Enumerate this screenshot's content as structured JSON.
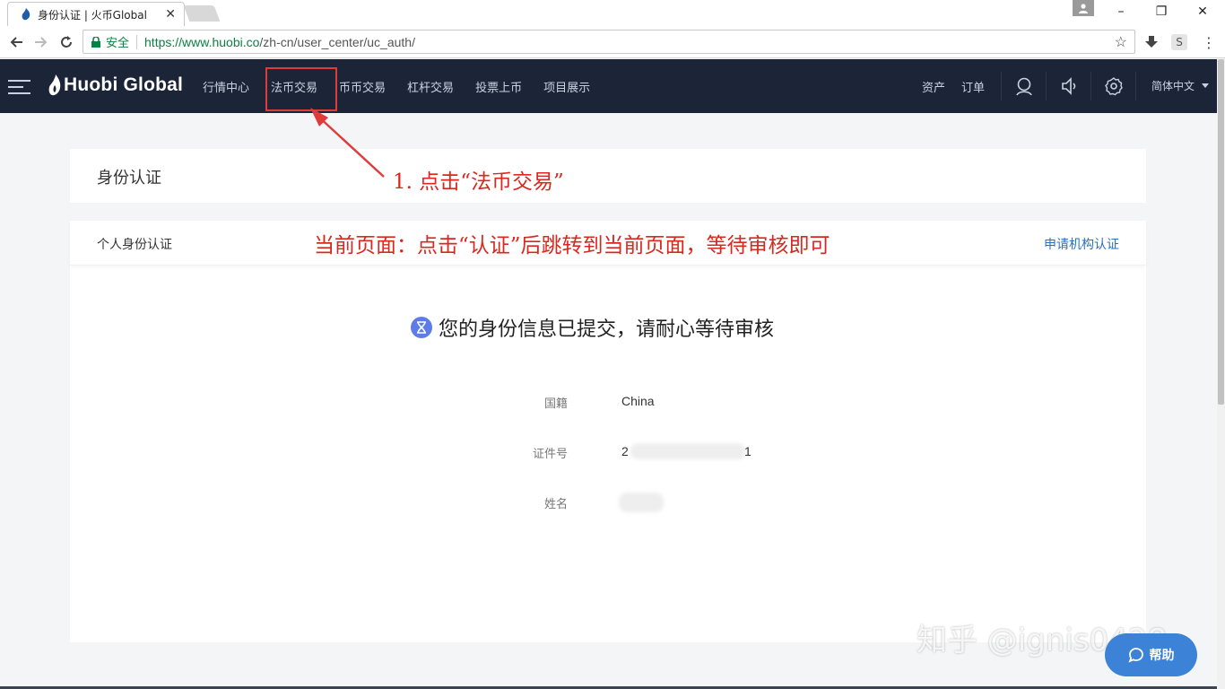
{
  "browser": {
    "tab_title": "身份认证 | 火币Global",
    "secure_label": "安全",
    "url_host": "https://www.huobi.co",
    "url_path": "/zh-cn/user_center/uc_auth/"
  },
  "header": {
    "logo_text": "Huobi Global",
    "nav_items": [
      "行情中心",
      "法币交易",
      "币币交易",
      "杠杆交易",
      "投票上币",
      "项目展示"
    ],
    "assets": "资产",
    "orders": "订单",
    "language": "简体中文"
  },
  "page": {
    "title": "身份认证",
    "section_title": "个人身份认证",
    "org_link": "申请机构认证",
    "status_message": "您的身份信息已提交，请耐心等待审核",
    "fields": [
      {
        "label": "国籍",
        "value": "China"
      },
      {
        "label": "证件号",
        "value_start": "2",
        "value_end": "1"
      },
      {
        "label": "姓名",
        "value": ""
      }
    ]
  },
  "annotations": {
    "step1": "1. 点击“法币交易”",
    "note": "当前页面：点击“认证”后跳转到当前页面，等待审核即可",
    "annotation_color": "#d9281f"
  },
  "watermark": "知乎 @ignis0428",
  "help_label": "帮助",
  "colors": {
    "header_bg": "#1b2537",
    "link": "#2a6fc5",
    "hourglass": "#5d7ce8",
    "help_bg": "#3c82d6"
  }
}
